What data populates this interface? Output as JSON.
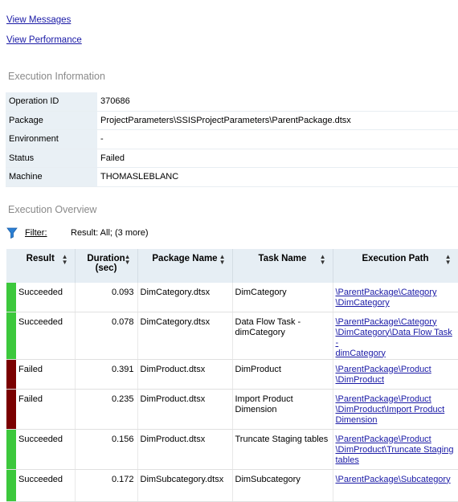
{
  "links": {
    "view_messages": "View Messages",
    "view_performance": "View Performance"
  },
  "execution_information": {
    "title": "Execution Information",
    "rows": [
      {
        "key": "Operation ID",
        "value": "370686"
      },
      {
        "key": "Package",
        "value": "ProjectParameters\\SSISProjectParameters\\ParentPackage.dtsx"
      },
      {
        "key": "Environment",
        "value": "-"
      },
      {
        "key": "Status",
        "value": "Failed"
      },
      {
        "key": "Machine",
        "value": "THOMASLEBLANC"
      }
    ]
  },
  "execution_overview": {
    "title": "Execution Overview",
    "filter_label": "Filter:",
    "filter_text": "Result: All;  (3 more)",
    "columns": {
      "result": "Result",
      "duration_line1": "Duration",
      "duration_line2": "(sec)",
      "package_name": "Package Name",
      "task_name": "Task Name",
      "execution_path": "Execution Path"
    },
    "status_colors": {
      "Succeeded": "#3cc83c",
      "Failed": "#7a0000"
    },
    "rows": [
      {
        "result": "Succeeded",
        "duration": "0.093",
        "package": "DimCategory.dtsx",
        "task": "DimCategory",
        "path": [
          "\\ParentPackage\\Category",
          "\\DimCategory"
        ]
      },
      {
        "result": "Succeeded",
        "duration": "0.078",
        "package": "DimCategory.dtsx",
        "task": "Data Flow Task - dimCategory",
        "path": [
          "\\ParentPackage\\Category",
          "\\DimCategory\\Data Flow Task -",
          "dimCategory"
        ]
      },
      {
        "result": "Failed",
        "duration": "0.391",
        "package": "DimProduct.dtsx",
        "task": "DimProduct",
        "path": [
          "\\ParentPackage\\Product",
          "\\DimProduct"
        ]
      },
      {
        "result": "Failed",
        "duration": "0.235",
        "package": "DimProduct.dtsx",
        "task": "Import Product Dimension",
        "path": [
          "\\ParentPackage\\Product",
          "\\DimProduct\\Import Product",
          "Dimension"
        ]
      },
      {
        "result": "Succeeded",
        "duration": "0.156",
        "package": "DimProduct.dtsx",
        "task": "Truncate Staging tables",
        "path": [
          "\\ParentPackage\\Product",
          "\\DimProduct\\Truncate Staging",
          "tables"
        ]
      },
      {
        "result": "Succeeded",
        "duration": "0.172",
        "package": "DimSubcategory.dtsx",
        "task": "DimSubcategory",
        "path": [
          "\\ParentPackage\\Subcategory"
        ]
      }
    ]
  }
}
